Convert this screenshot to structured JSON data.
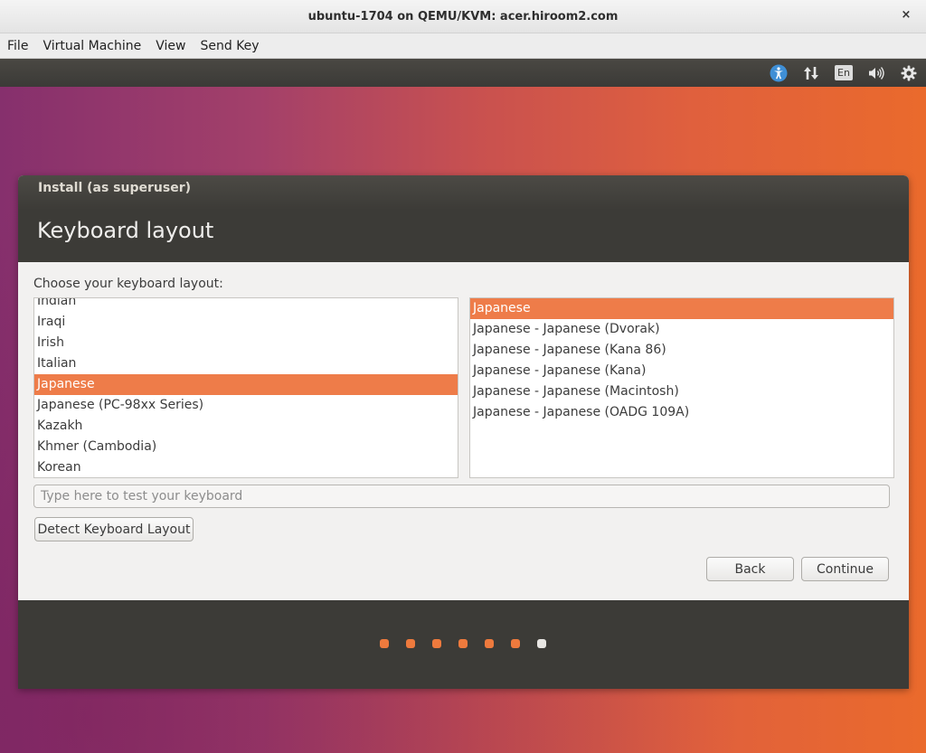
{
  "window": {
    "title": "ubuntu-1704 on QEMU/KVM: acer.hiroom2.com",
    "close_glyph": "×"
  },
  "menubar": {
    "items": [
      "File",
      "Virtual Machine",
      "View",
      "Send Key"
    ]
  },
  "top_panel": {
    "icons": [
      "accessibility-icon",
      "network-icon",
      "keyboard-indicator",
      "volume-icon",
      "system-gear-icon"
    ],
    "keyboard_indicator": "En"
  },
  "installer": {
    "window_title": "Install (as superuser)",
    "heading": "Keyboard layout",
    "choose_label": "Choose your keyboard layout:",
    "layouts": [
      {
        "label": "Indian",
        "selected": false
      },
      {
        "label": "Iraqi",
        "selected": false
      },
      {
        "label": "Irish",
        "selected": false
      },
      {
        "label": "Italian",
        "selected": false
      },
      {
        "label": "Japanese",
        "selected": true
      },
      {
        "label": "Japanese (PC-98xx Series)",
        "selected": false
      },
      {
        "label": "Kazakh",
        "selected": false
      },
      {
        "label": "Khmer (Cambodia)",
        "selected": false
      },
      {
        "label": "Korean",
        "selected": false
      }
    ],
    "variants": [
      {
        "label": "Japanese",
        "selected": true
      },
      {
        "label": "Japanese - Japanese (Dvorak)",
        "selected": false
      },
      {
        "label": "Japanese - Japanese (Kana 86)",
        "selected": false
      },
      {
        "label": "Japanese - Japanese (Kana)",
        "selected": false
      },
      {
        "label": "Japanese - Japanese (Macintosh)",
        "selected": false
      },
      {
        "label": "Japanese - Japanese (OADG 109A)",
        "selected": false
      }
    ],
    "test_input": {
      "value": "",
      "placeholder": "Type here to test your keyboard"
    },
    "detect_button": "Detect Keyboard Layout",
    "back_button": "Back",
    "continue_button": "Continue",
    "progress": {
      "total_steps": 7,
      "current_step": 7
    }
  },
  "colors": {
    "selection": "#ee7c49",
    "header_bg": "#3c3b37",
    "progress_dot": "#ee7a3d",
    "progress_dot_current": "#e8e6e3"
  }
}
